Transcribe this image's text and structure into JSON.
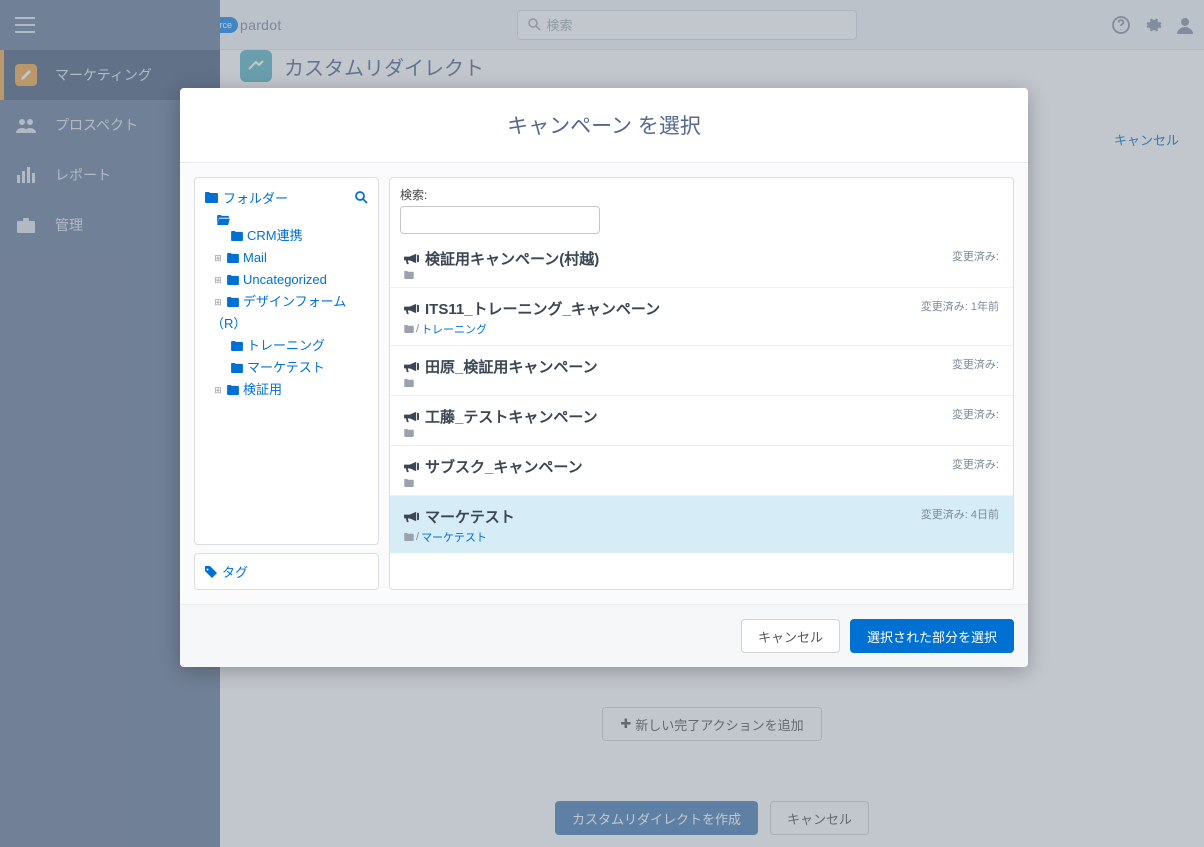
{
  "topbar": {
    "logo_cloud": "salesforce",
    "logo_text": "pardot",
    "search_placeholder": "検索"
  },
  "sidebar": {
    "items": [
      {
        "label": "マーケティング"
      },
      {
        "label": "プロスペクト"
      },
      {
        "label": "レポート"
      },
      {
        "label": "管理"
      }
    ]
  },
  "page": {
    "title": "カスタムリダイレクト",
    "cancel_link": "キャンセル",
    "add_action": "新しい完了アクションを追加",
    "create_button": "カスタムリダイレクトを作成",
    "cancel_button": "キャンセル"
  },
  "modal": {
    "title": "キャンペーン を選択",
    "folder_label": "フォルダー",
    "search_label": "検索:",
    "tags_label": "タグ",
    "cancel": "キャンセル",
    "select": "選択された部分を選択",
    "tree": [
      {
        "label": "CRM連携",
        "indent": 2,
        "expandable": false
      },
      {
        "label": "Mail",
        "indent": 1,
        "expandable": true
      },
      {
        "label": "Uncategorized",
        "indent": 1,
        "expandable": true
      },
      {
        "label": "デザインフォーム（R）",
        "indent": 1,
        "expandable": true,
        "wrap": true
      },
      {
        "label": "トレーニング",
        "indent": 2,
        "expandable": false
      },
      {
        "label": "マーケテスト",
        "indent": 2,
        "expandable": false
      },
      {
        "label": "検証用",
        "indent": 1,
        "expandable": true
      }
    ],
    "results": [
      {
        "title": "検証用キャンペーン(村越)",
        "meta": "変更済み:",
        "path": ""
      },
      {
        "title": "ITS11_トレーニング_キャンペーン",
        "meta": "変更済み: 1年前",
        "path": "トレーニング"
      },
      {
        "title": "田原_検証用キャンペーン",
        "meta": "変更済み:",
        "path": ""
      },
      {
        "title": "工藤_テストキャンペーン",
        "meta": "変更済み:",
        "path": ""
      },
      {
        "title": "サブスク_キャンペーン",
        "meta": "変更済み:",
        "path": ""
      },
      {
        "title": "マーケテスト",
        "meta": "変更済み: 4日前",
        "path": "マーケテスト",
        "selected": true
      }
    ]
  }
}
